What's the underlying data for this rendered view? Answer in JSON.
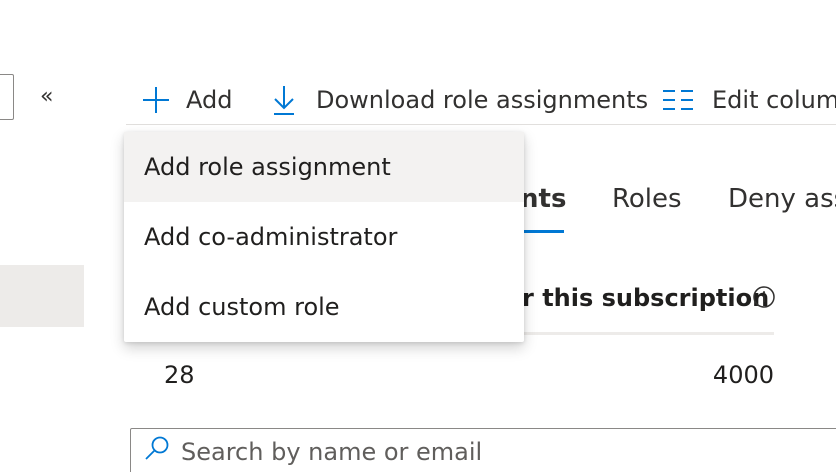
{
  "commandbar": {
    "add_label": "Add",
    "download_label": "Download role assignments",
    "edit_columns_label": "Edit colum",
    "collapse_glyph": "«"
  },
  "add_menu": {
    "items": [
      {
        "label": "Add role assignment",
        "highlighted": true
      },
      {
        "label": "Add co-administrator",
        "highlighted": false
      },
      {
        "label": "Add custom role",
        "highlighted": false
      }
    ]
  },
  "tabs": {
    "active_fragment": "nts",
    "roles": "Roles",
    "deny": "Deny ass"
  },
  "summary": {
    "subtitle_fragment": "r this subscription",
    "current_count": "28",
    "max_count": "4000"
  },
  "search": {
    "placeholder": "Search by name or email"
  },
  "colors": {
    "accent": "#0078d4",
    "text": "#201f1e",
    "menu_hover": "#f3f2f1",
    "selected_nav": "#edebe9"
  },
  "icons": {
    "add": "plus-icon",
    "download": "download-icon",
    "edit_columns": "columns-icon",
    "info": "info-icon",
    "search": "search-icon",
    "collapse": "double-chevron-left-icon"
  }
}
